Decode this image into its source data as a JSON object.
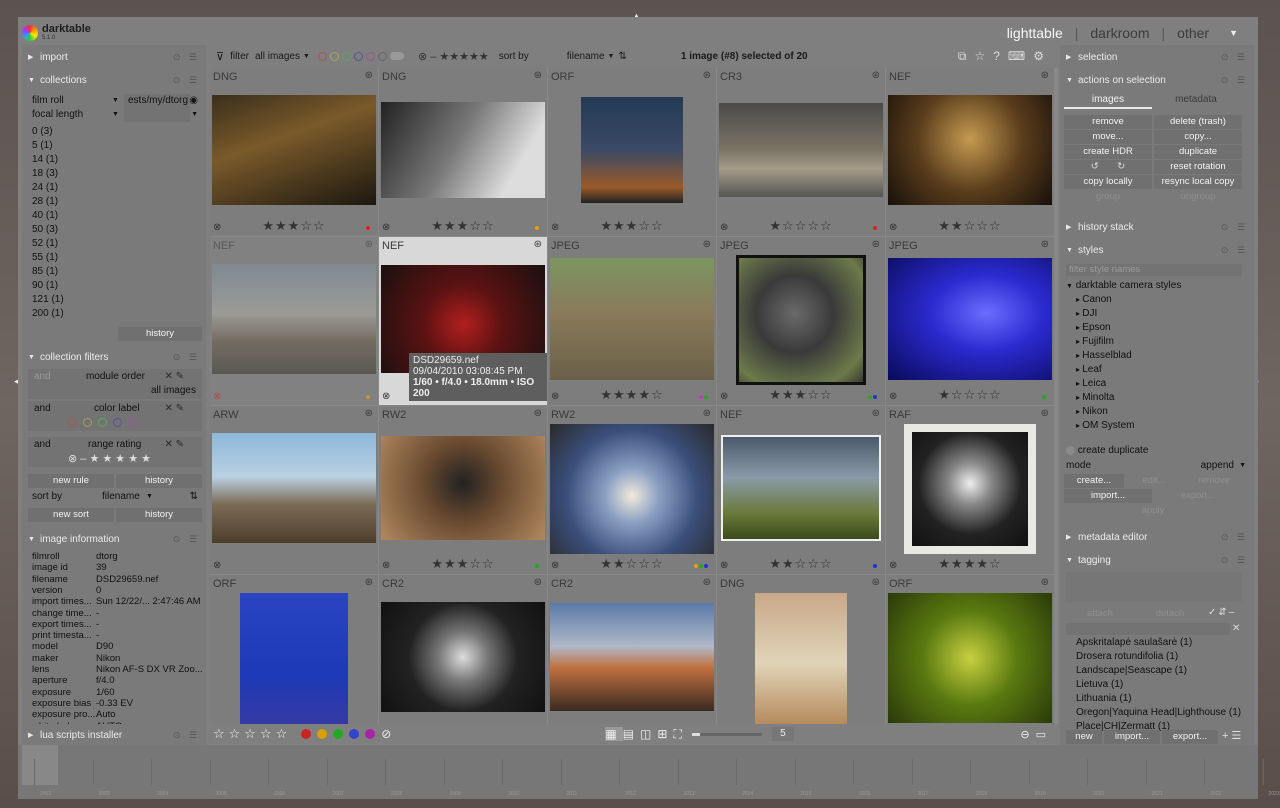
{
  "app": {
    "name": "darktable",
    "version": "5.1.0"
  },
  "views": {
    "lighttable": "lighttable",
    "darkroom": "darkroom",
    "other": "other"
  },
  "left": {
    "import": "import",
    "collections": "collections",
    "coll_rule": "film roll",
    "coll_path": "ests/my/dtorg",
    "coll_sub": "focal length",
    "focal_items": [
      "0 (3)",
      "5 (1)",
      "14 (1)",
      "18 (3)",
      "24 (1)",
      "28 (1)",
      "40 (1)",
      "50 (3)",
      "52 (1)",
      "55 (1)",
      "85 (1)",
      "90 (1)",
      "121 (1)",
      "200 (1)"
    ],
    "history": "history",
    "collection_filters": "collection filters",
    "and1": "and",
    "module_order": "module order",
    "all_images": "all images",
    "and2": "and",
    "color_label": "color label",
    "and3": "and",
    "range_rating": "range rating",
    "new_rule": "new rule",
    "history2": "history",
    "sort_by": "sort by",
    "sort_field": "filename",
    "new_sort": "new sort",
    "history3": "history",
    "image_information": "image information",
    "info": [
      [
        "filmroll",
        "dtorg"
      ],
      [
        "image id",
        "39"
      ],
      [
        "filename",
        "DSD29659.nef"
      ],
      [
        "version",
        "0"
      ],
      [
        "import times...",
        "Sun 12/22/... 2:47:46 AM"
      ],
      [
        "change time...",
        "-"
      ],
      [
        "export times...",
        "-"
      ],
      [
        "print timesta...",
        "-"
      ],
      [
        "model",
        "D90"
      ],
      [
        "maker",
        "Nikon"
      ],
      [
        "lens",
        "Nikon AF-S DX VR Zoo..."
      ],
      [
        "aperture",
        "f/4.0"
      ],
      [
        "exposure",
        "1/60"
      ],
      [
        "exposure bias",
        "-0.33 EV"
      ],
      [
        "exposure pro...",
        "Auto"
      ],
      [
        "white balance",
        "AUTO"
      ]
    ],
    "lua": "lua scripts installer"
  },
  "top": {
    "filter": "filter",
    "filter_value": "all images",
    "sort_by": "sort by",
    "sort_value": "filename",
    "count_text": "1 image (#8) selected of 20"
  },
  "grid": [
    {
      "fmt": "DNG",
      "stars": "★★★☆☆",
      "dots": [
        "#d22"
      ],
      "selected": false
    },
    {
      "fmt": "DNG",
      "stars": "★★★☆☆",
      "dots": [
        "#e8a000"
      ]
    },
    {
      "fmt": "ORF",
      "stars": "★★★☆☆",
      "dots": []
    },
    {
      "fmt": "CR3",
      "stars": "★☆☆☆☆",
      "dots": [
        "#d22"
      ]
    },
    {
      "fmt": "NEF",
      "stars": "★★☆☆☆",
      "dots": []
    },
    {
      "fmt": "NEF",
      "stars": "",
      "dots": [
        "#e8a000"
      ]
    },
    {
      "fmt": "NEF",
      "stars": "★★☆☆☆",
      "dots": [
        "#c3c"
      ]
    },
    {
      "fmt": "JPEG",
      "stars": "★★★★☆",
      "dots": [
        "#c3c",
        "#2a2"
      ]
    },
    {
      "fmt": "JPEG",
      "stars": "★★★☆☆",
      "dots": [
        "#2a2",
        "#23c"
      ]
    },
    {
      "fmt": "JPEG",
      "stars": "★☆☆☆☆",
      "dots": [
        "#2a2"
      ]
    },
    {
      "fmt": "ARW",
      "stars": "",
      "dots": []
    },
    {
      "fmt": "RW2",
      "stars": "★★★☆☆",
      "dots": [
        "#2a2"
      ]
    },
    {
      "fmt": "RW2",
      "stars": "★★☆☆☆",
      "dots": [
        "#e8a000",
        "#2a2",
        "#23c"
      ]
    },
    {
      "fmt": "NEF",
      "stars": "★★☆☆☆",
      "dots": [
        "#23c"
      ]
    },
    {
      "fmt": "RAF",
      "stars": "★★★★☆",
      "dots": []
    },
    {
      "fmt": "ORF",
      "stars": "",
      "dots": []
    },
    {
      "fmt": "CR2",
      "stars": "",
      "dots": []
    },
    {
      "fmt": "CR2",
      "stars": "",
      "dots": []
    },
    {
      "fmt": "DNG",
      "stars": "",
      "dots": []
    },
    {
      "fmt": "ORF",
      "stars": "",
      "dots": []
    }
  ],
  "tooltip": {
    "file": "DSD29659.nef",
    "date": "09/04/2010 03:08:45 PM",
    "exif": "1/60 • f/4.0 • 18.0mm • ISO 200"
  },
  "right": {
    "selection": "selection",
    "actions": "actions on selection",
    "tab_images": "images",
    "tab_metadata": "metadata",
    "remove": "remove",
    "delete": "delete (trash)",
    "move": "move...",
    "copy": "copy...",
    "create_hdr": "create HDR",
    "duplicate": "duplicate",
    "reset_rotation": "reset rotation",
    "copy_locally": "copy locally",
    "resync": "resync local copy",
    "group": "group",
    "ungroup": "ungroup",
    "history_stack": "history stack",
    "styles": "styles",
    "filter_styles": "filter style names",
    "camera_styles": "darktable camera styles",
    "style_items": [
      "Canon",
      "DJI",
      "Epson",
      "Fujifilm",
      "Hasselblad",
      "Leaf",
      "Leica",
      "Minolta",
      "Nikon",
      "OM System"
    ],
    "create_duplicate": "create duplicate",
    "mode": "mode",
    "mode_value": "append",
    "create": "create...",
    "edit": "edit...",
    "remove_style": "remove",
    "import_style": "import...",
    "export_style": "export...",
    "apply": "apply",
    "metadata_editor": "metadata editor",
    "tagging": "tagging",
    "attach": "attach",
    "detach": "detach",
    "tags": [
      "Apskritalapė saulašarė (1)",
      "Drosera rotundifolia (1)",
      "Landscape|Seascape (1)",
      "Lietuva (1)",
      "Lithuania (1)",
      "Oregon|Yaquina Head|Lighthouse (1)",
      "Place|CH|Zermatt (1)"
    ],
    "new": "new",
    "import_tag": "import...",
    "export_tag": "export..."
  },
  "bottom": {
    "zoom": "5"
  },
  "timeline": [
    "2002",
    "2003",
    "2004",
    "2005",
    "2006",
    "2007",
    "2008",
    "2009",
    "2010",
    "2011",
    "2012",
    "2013",
    "2014",
    "2015",
    "2016",
    "2017",
    "2018",
    "2019",
    "2020",
    "2021",
    "2022",
    "2023"
  ]
}
